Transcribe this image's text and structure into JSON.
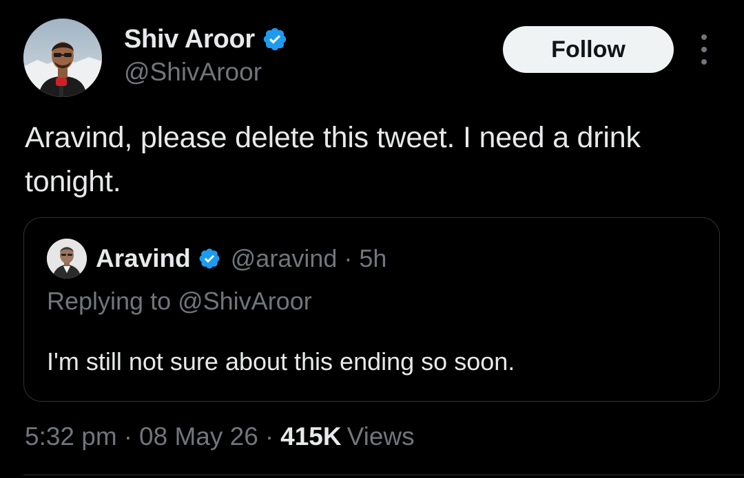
{
  "author": {
    "name": "Shiv Aroor",
    "handle": "@ShivAroor",
    "verified": true,
    "avatar_icon": "profile-photo"
  },
  "actions": {
    "follow_label": "Follow",
    "more_icon": "more-vertical-icon"
  },
  "tweet": {
    "text": "Aravind, please delete this tweet. I need a drink tonight."
  },
  "quoted": {
    "name": "Aravind",
    "handle": "@aravind",
    "separator": "·",
    "time": "5h",
    "replying_to": "Replying to @ShivAroor",
    "text": "I'm still not sure about this ending so soon.",
    "verified": true
  },
  "meta": {
    "time": "5:32 pm",
    "date": "08 May 26",
    "views_count": "415K",
    "views_label": "Views",
    "separator": "·"
  },
  "colors": {
    "background": "#000000",
    "text_primary": "#e7e9ea",
    "text_secondary": "#71767b",
    "verified_blue": "#1d9bf0",
    "border": "#2f3336",
    "follow_bg": "#eff3f4"
  }
}
